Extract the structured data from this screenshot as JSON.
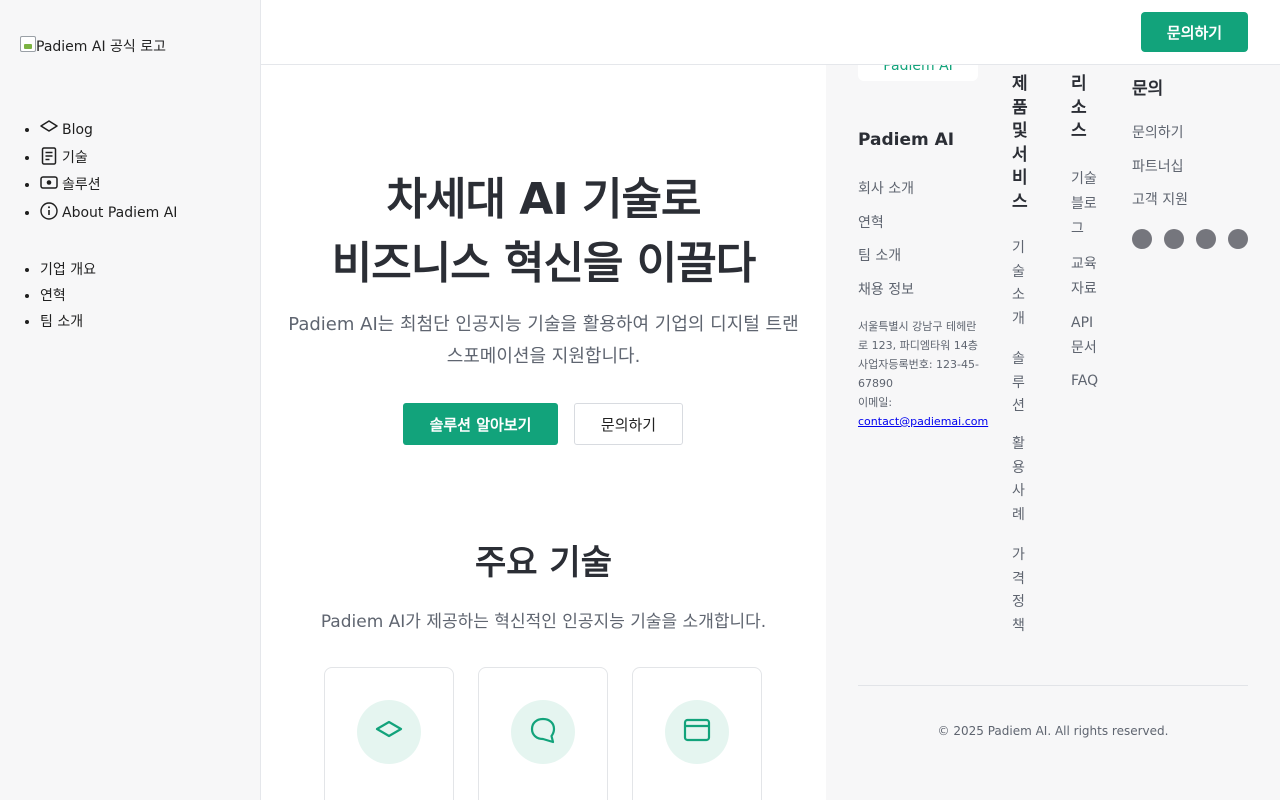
{
  "header": {
    "cta_label": "문의하기"
  },
  "sidebar": {
    "logo_alt": "Padiem AI 공식 로고",
    "primary_items": [
      {
        "label": "Blog",
        "icon": "diamond-icon"
      },
      {
        "label": "기술",
        "icon": "document-icon"
      },
      {
        "label": "솔루션",
        "icon": "camera-icon"
      },
      {
        "label": "About Padiem AI",
        "icon": "info-icon"
      }
    ],
    "secondary_items": [
      {
        "label": "기업 개요"
      },
      {
        "label": "연혁"
      },
      {
        "label": "팀 소개"
      }
    ]
  },
  "hero": {
    "title_line1": "차세대 AI 기술로",
    "title_line2": "비즈니스 혁신을 이끌다",
    "subtitle": "Padiem AI는 최첨단 인공지능 기술을 활용하여 기업의 디지털 트랜스포메이션을 지원합니다.",
    "primary_button": "솔루션 알아보기",
    "secondary_button": "문의하기"
  },
  "tech_section": {
    "title": "주요 기술",
    "subtitle": "Padiem AI가 제공하는 혁신적인 인공지능 기술을 소개합니다.",
    "cards": [
      {
        "icon": "diamond-icon"
      },
      {
        "icon": "chat-bubble-icon"
      },
      {
        "icon": "browser-window-icon"
      }
    ]
  },
  "footer": {
    "logo_text": "Padiem AI",
    "company": {
      "title": "Padiem AI",
      "links": [
        "회사 소개",
        "연혁",
        "팀 소개",
        "채용 정보"
      ],
      "address_line1": "서울특별시 강남구 테헤란로 123, 파디엠타워 14층",
      "business_number": "사업자등록번호: 123-45-67890",
      "email_label": "이메일:",
      "email": "contact@padiemai.com"
    },
    "products": {
      "title": "제품 및 서비스",
      "links": [
        "기술 소개",
        "솔루션",
        "활용 사례",
        "가격 정책"
      ]
    },
    "resources": {
      "title": "리소스",
      "links": [
        "기술 블로그",
        "교육 자료",
        "API 문서",
        "FAQ"
      ]
    },
    "contact": {
      "title": "문의",
      "links": [
        "문의하기",
        "파트너십",
        "고객 지원"
      ]
    },
    "social_icons": [
      "social-icon-1",
      "social-icon-2",
      "social-icon-3",
      "social-icon-4"
    ],
    "copyright": "© 2025 Padiem AI. All rights reserved."
  },
  "colors": {
    "accent": "#12a37b",
    "heading": "#2b2e35",
    "muted": "#5f6570",
    "panel_bg": "#f7f7f8"
  }
}
